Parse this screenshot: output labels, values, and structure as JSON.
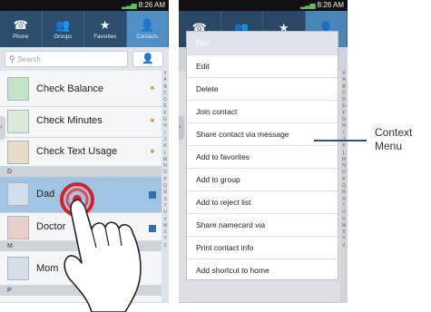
{
  "status_bar": {
    "time": "8:26 AM"
  },
  "tabs": [
    {
      "label": "Phone",
      "icon": "phone-icon",
      "glyph": "☎"
    },
    {
      "label": "Groups",
      "icon": "groups-icon",
      "glyph": "👥"
    },
    {
      "label": "Favorites",
      "icon": "star-icon",
      "glyph": "★"
    },
    {
      "label": "Contacts",
      "icon": "person-icon",
      "glyph": "👤"
    }
  ],
  "search": {
    "placeholder": "Search"
  },
  "contacts": {
    "items": [
      {
        "name": "Check Balance"
      },
      {
        "name": "Check Minutes"
      },
      {
        "name": "Check Text Usage"
      },
      {
        "section": "D"
      },
      {
        "name": "Dad"
      },
      {
        "name": "Doctor"
      },
      {
        "section": "M"
      },
      {
        "name": "Mom"
      },
      {
        "section": "P"
      }
    ]
  },
  "alpha_index": [
    "#",
    "A",
    "B",
    "C",
    "D",
    "E",
    "F",
    "G",
    "H",
    "I",
    "J",
    "K",
    "L",
    "M",
    "N",
    "O",
    "P",
    "Q",
    "R",
    "S",
    "T",
    "U",
    "V",
    "W",
    "X",
    "Y",
    "Z"
  ],
  "context_menu": {
    "title": "Dad",
    "items": [
      "Edit",
      "Delete",
      "Join contact",
      "Share contact via message",
      "Add to favorites",
      "Add to group",
      "Add to reject list",
      "Share namecard via",
      "Print contact info",
      "Add shortcut to home"
    ]
  },
  "callout": {
    "line1": "Context",
    "line2": "Menu"
  },
  "colors": {
    "tab_bar": "#2c4d6b",
    "tab_active": "#4f8fc4",
    "selected_row": "#9fc4e4",
    "touch_ring": "#d9202a"
  }
}
